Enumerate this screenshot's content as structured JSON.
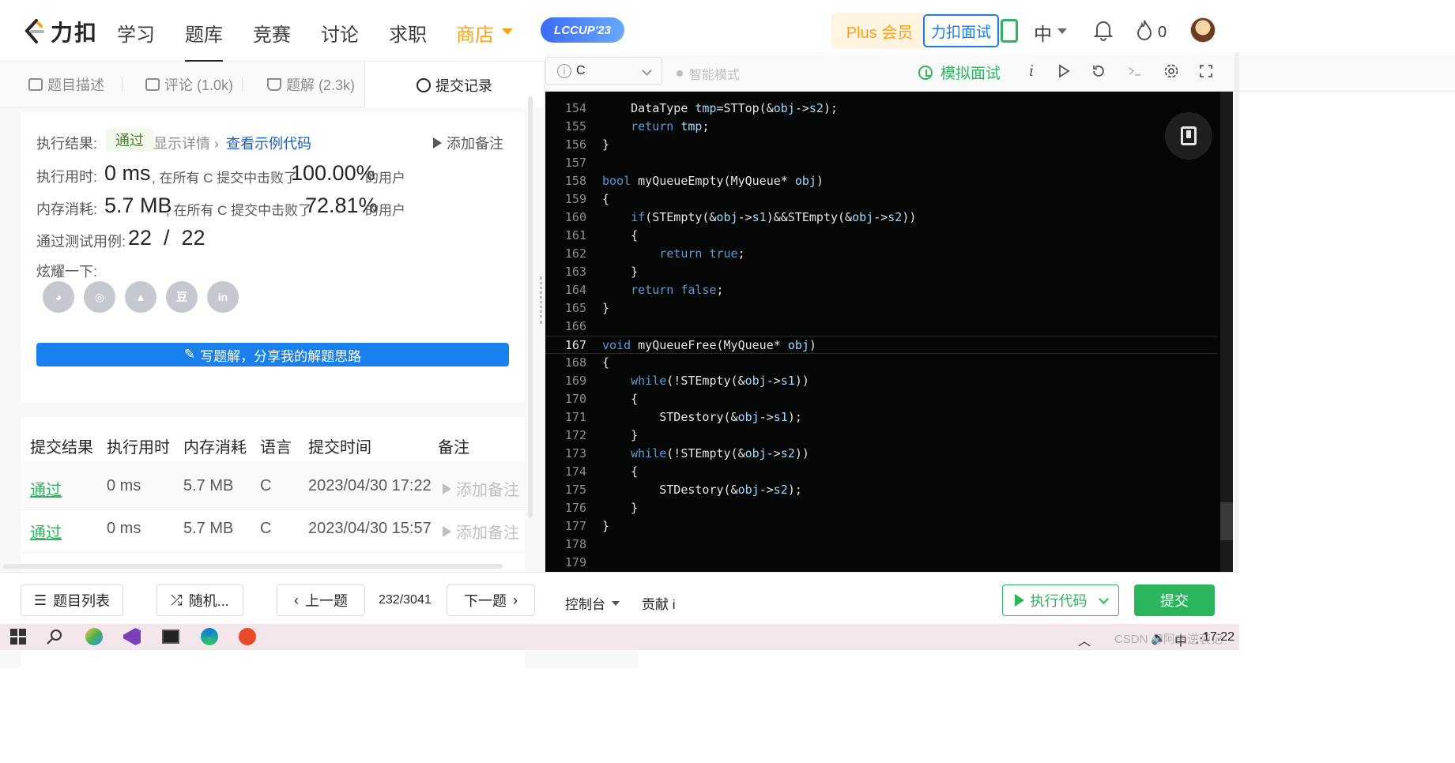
{
  "nav": {
    "logo_text": "力扣",
    "items": [
      "学习",
      "题库",
      "竞赛",
      "讨论",
      "求职"
    ],
    "active_item": "题库",
    "store_label": "商店",
    "lccup_label": "LCCUP'23",
    "plus_label": "Plus 会员",
    "interview_label": "力扣面试",
    "lang_label": "中",
    "flame_count": "0"
  },
  "left_tabs": [
    {
      "label": "题目描述"
    },
    {
      "label": "评论 (1.0k)"
    },
    {
      "label": "题解 (2.3k)"
    },
    {
      "label": "提交记录"
    }
  ],
  "result": {
    "result_label": "执行结果:",
    "status": "通过",
    "detail_link": "显示详情 ›",
    "sample_link": "查看示例代码",
    "add_note": "添加备注",
    "runtime_label": "执行用时:",
    "runtime_value": "0 ms",
    "runtime_text": ", 在所有 C 提交中击败了",
    "runtime_percent": "100.00%",
    "runtime_suffix": "的用户",
    "memory_label": "内存消耗:",
    "memory_value": "5.7 MB",
    "memory_text": ", 在所有 C 提交中击败了",
    "memory_percent": "72.81%",
    "memory_suffix": "的用户",
    "testcase_label": "通过测试用例:",
    "testcase_value": "22  /  22",
    "share_label": "炫耀一下:",
    "share_icons": [
      "wechat-icon",
      "weibo-icon",
      "qq-icon",
      "douban-icon",
      "linkedin-icon"
    ],
    "share_glyphs": [
      "◕",
      "◎",
      "▲",
      "豆",
      "in"
    ],
    "write_btn": "写题解，分享我的解题思路"
  },
  "table": {
    "headers": [
      "提交结果",
      "执行用时",
      "内存消耗",
      "语言",
      "提交时间",
      "备注"
    ],
    "rows": [
      {
        "status": "通过",
        "time": "0 ms",
        "memory": "5.7 MB",
        "lang": "C",
        "submitted": "2023/04/30 17:22",
        "note": "添加备注"
      },
      {
        "status": "通过",
        "time": "0 ms",
        "memory": "5.7 MB",
        "lang": "C",
        "submitted": "2023/04/30 15:57",
        "note": "添加备注"
      }
    ]
  },
  "editor_toolbar": {
    "language": "C",
    "smart_mode": "智能模式",
    "mock_interview": "模拟面试"
  },
  "code": {
    "active_line": 167,
    "lines": [
      {
        "n": 154,
        "text": "    DataType tmp=STTop(&obj->s2);"
      },
      {
        "n": 155,
        "text": "    return tmp;"
      },
      {
        "n": 156,
        "text": "}"
      },
      {
        "n": 157,
        "text": ""
      },
      {
        "n": 158,
        "text": "bool myQueueEmpty(MyQueue* obj)"
      },
      {
        "n": 159,
        "text": "{"
      },
      {
        "n": 160,
        "text": "    if(STEmpty(&obj->s1)&&STEmpty(&obj->s2))"
      },
      {
        "n": 161,
        "text": "    {"
      },
      {
        "n": 162,
        "text": "        return true;"
      },
      {
        "n": 163,
        "text": "    }"
      },
      {
        "n": 164,
        "text": "    return false;"
      },
      {
        "n": 165,
        "text": "}"
      },
      {
        "n": 166,
        "text": ""
      },
      {
        "n": 167,
        "text": "void myQueueFree(MyQueue* obj)"
      },
      {
        "n": 168,
        "text": "{"
      },
      {
        "n": 169,
        "text": "    while(!STEmpty(&obj->s1))"
      },
      {
        "n": 170,
        "text": "    {"
      },
      {
        "n": 171,
        "text": "        STDestory(&obj->s1);"
      },
      {
        "n": 172,
        "text": "    }"
      },
      {
        "n": 173,
        "text": "    while(!STEmpty(&obj->s2))"
      },
      {
        "n": 174,
        "text": "    {"
      },
      {
        "n": 175,
        "text": "        STDestory(&obj->s2);"
      },
      {
        "n": 176,
        "text": "    }"
      },
      {
        "n": 177,
        "text": "}"
      },
      {
        "n": 178,
        "text": ""
      },
      {
        "n": 179,
        "text": ""
      }
    ]
  },
  "bottom": {
    "problem_list": "题目列表",
    "random": "随机...",
    "prev": "上一题",
    "page": "232/3041",
    "next": "下一题",
    "console": "控制台",
    "contribute": "贡献 i",
    "run": "执行代码",
    "submit": "提交"
  },
  "taskbar": {
    "time": "17:22",
    "ime": "中",
    "watermark": "CSDN @阿由逆袭记"
  },
  "colors": {
    "accent_green": "#2db55d",
    "store_orange": "#ffa116",
    "link_blue": "#1a80ee",
    "keyword_blue": "#569cd6"
  }
}
